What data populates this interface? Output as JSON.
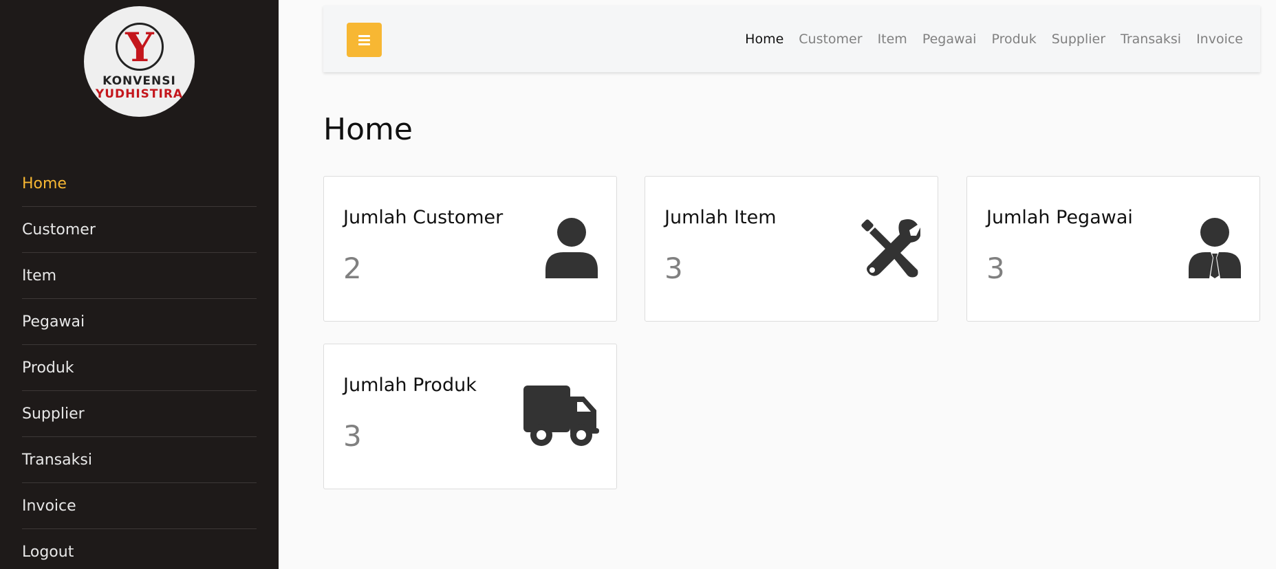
{
  "logo": {
    "letter": "Y",
    "line1": "KONVENSI",
    "line2": "YUDHISTIRA"
  },
  "sidebar": {
    "items": [
      {
        "label": "Home"
      },
      {
        "label": "Customer"
      },
      {
        "label": "Item"
      },
      {
        "label": "Pegawai"
      },
      {
        "label": "Produk"
      },
      {
        "label": "Supplier"
      },
      {
        "label": "Transaksi"
      },
      {
        "label": "Invoice"
      },
      {
        "label": "Logout"
      }
    ]
  },
  "topnav": {
    "links": [
      {
        "label": "Home"
      },
      {
        "label": "Customer"
      },
      {
        "label": "Item"
      },
      {
        "label": "Pegawai"
      },
      {
        "label": "Produk"
      },
      {
        "label": "Supplier"
      },
      {
        "label": "Transaksi"
      },
      {
        "label": "Invoice"
      }
    ]
  },
  "page": {
    "title": "Home"
  },
  "cards": [
    {
      "title": "Jumlah Customer",
      "value": "2",
      "icon": "user-icon"
    },
    {
      "title": "Jumlah Item",
      "value": "3",
      "icon": "tools-icon"
    },
    {
      "title": "Jumlah Pegawai",
      "value": "3",
      "icon": "user-tie-icon"
    },
    {
      "title": "Jumlah Produk",
      "value": "3",
      "icon": "truck-icon"
    }
  ],
  "colors": {
    "accent": "#f7b733",
    "sidebar_bg": "#1e1a19",
    "brand_red": "#c4161c"
  }
}
